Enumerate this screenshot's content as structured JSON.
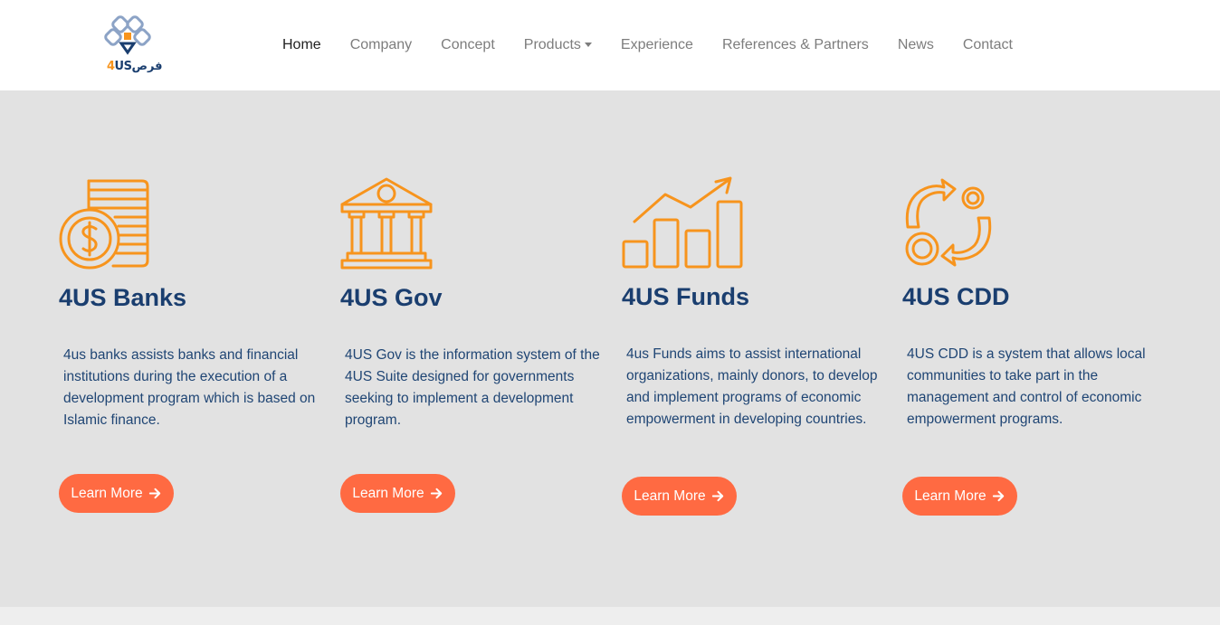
{
  "brand": {
    "logo_prefix": "4",
    "logo_suffix": "US",
    "logo_arabic": "فرص"
  },
  "nav": {
    "items": [
      {
        "label": "Home"
      },
      {
        "label": "Company"
      },
      {
        "label": "Concept"
      },
      {
        "label": "Products"
      },
      {
        "label": "Experience"
      },
      {
        "label": "References & Partners"
      },
      {
        "label": "News"
      },
      {
        "label": "Contact"
      }
    ]
  },
  "products": [
    {
      "title": "4US Banks",
      "description": "4us banks assists banks and financial institutions during the execution of a development program which is based on Islamic finance.",
      "button": "Learn More",
      "icon": "coins-icon"
    },
    {
      "title": "4US Gov",
      "description": "4US Gov is the information system of the 4US Suite designed for governments seeking to implement a development program.",
      "button": "Learn More",
      "icon": "government-building-icon"
    },
    {
      "title": "4US Funds",
      "description": "4us Funds aims to assist international organizations, mainly donors, to develop and implement programs of economic empowerment in developing countries.",
      "button": "Learn More",
      "icon": "growth-chart-icon"
    },
    {
      "title": "4US CDD",
      "description": "4US CDD is a system that allows local communities to take part in the management and control of economic empowerment programs.",
      "button": "Learn More",
      "icon": "exchange-cycle-icon"
    }
  ],
  "colors": {
    "accent": "#f7941d",
    "button": "#ff6a42",
    "heading": "#1a3e6f",
    "section_bg": "#e2e2e2"
  }
}
